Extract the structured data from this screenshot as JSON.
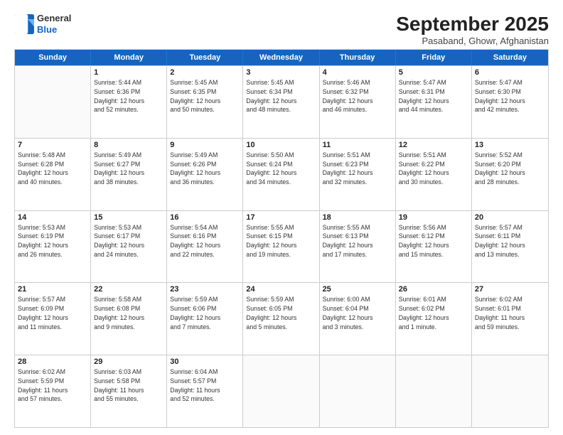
{
  "logo": {
    "general": "General",
    "blue": "Blue"
  },
  "title": "September 2025",
  "subtitle": "Pasaband, Ghowr, Afghanistan",
  "days": [
    "Sunday",
    "Monday",
    "Tuesday",
    "Wednesday",
    "Thursday",
    "Friday",
    "Saturday"
  ],
  "weeks": [
    [
      {
        "day": "",
        "info": ""
      },
      {
        "day": "1",
        "info": "Sunrise: 5:44 AM\nSunset: 6:36 PM\nDaylight: 12 hours\nand 52 minutes."
      },
      {
        "day": "2",
        "info": "Sunrise: 5:45 AM\nSunset: 6:35 PM\nDaylight: 12 hours\nand 50 minutes."
      },
      {
        "day": "3",
        "info": "Sunrise: 5:45 AM\nSunset: 6:34 PM\nDaylight: 12 hours\nand 48 minutes."
      },
      {
        "day": "4",
        "info": "Sunrise: 5:46 AM\nSunset: 6:32 PM\nDaylight: 12 hours\nand 46 minutes."
      },
      {
        "day": "5",
        "info": "Sunrise: 5:47 AM\nSunset: 6:31 PM\nDaylight: 12 hours\nand 44 minutes."
      },
      {
        "day": "6",
        "info": "Sunrise: 5:47 AM\nSunset: 6:30 PM\nDaylight: 12 hours\nand 42 minutes."
      }
    ],
    [
      {
        "day": "7",
        "info": "Sunrise: 5:48 AM\nSunset: 6:28 PM\nDaylight: 12 hours\nand 40 minutes."
      },
      {
        "day": "8",
        "info": "Sunrise: 5:49 AM\nSunset: 6:27 PM\nDaylight: 12 hours\nand 38 minutes."
      },
      {
        "day": "9",
        "info": "Sunrise: 5:49 AM\nSunset: 6:26 PM\nDaylight: 12 hours\nand 36 minutes."
      },
      {
        "day": "10",
        "info": "Sunrise: 5:50 AM\nSunset: 6:24 PM\nDaylight: 12 hours\nand 34 minutes."
      },
      {
        "day": "11",
        "info": "Sunrise: 5:51 AM\nSunset: 6:23 PM\nDaylight: 12 hours\nand 32 minutes."
      },
      {
        "day": "12",
        "info": "Sunrise: 5:51 AM\nSunset: 6:22 PM\nDaylight: 12 hours\nand 30 minutes."
      },
      {
        "day": "13",
        "info": "Sunrise: 5:52 AM\nSunset: 6:20 PM\nDaylight: 12 hours\nand 28 minutes."
      }
    ],
    [
      {
        "day": "14",
        "info": "Sunrise: 5:53 AM\nSunset: 6:19 PM\nDaylight: 12 hours\nand 26 minutes."
      },
      {
        "day": "15",
        "info": "Sunrise: 5:53 AM\nSunset: 6:17 PM\nDaylight: 12 hours\nand 24 minutes."
      },
      {
        "day": "16",
        "info": "Sunrise: 5:54 AM\nSunset: 6:16 PM\nDaylight: 12 hours\nand 22 minutes."
      },
      {
        "day": "17",
        "info": "Sunrise: 5:55 AM\nSunset: 6:15 PM\nDaylight: 12 hours\nand 19 minutes."
      },
      {
        "day": "18",
        "info": "Sunrise: 5:55 AM\nSunset: 6:13 PM\nDaylight: 12 hours\nand 17 minutes."
      },
      {
        "day": "19",
        "info": "Sunrise: 5:56 AM\nSunset: 6:12 PM\nDaylight: 12 hours\nand 15 minutes."
      },
      {
        "day": "20",
        "info": "Sunrise: 5:57 AM\nSunset: 6:11 PM\nDaylight: 12 hours\nand 13 minutes."
      }
    ],
    [
      {
        "day": "21",
        "info": "Sunrise: 5:57 AM\nSunset: 6:09 PM\nDaylight: 12 hours\nand 11 minutes."
      },
      {
        "day": "22",
        "info": "Sunrise: 5:58 AM\nSunset: 6:08 PM\nDaylight: 12 hours\nand 9 minutes."
      },
      {
        "day": "23",
        "info": "Sunrise: 5:59 AM\nSunset: 6:06 PM\nDaylight: 12 hours\nand 7 minutes."
      },
      {
        "day": "24",
        "info": "Sunrise: 5:59 AM\nSunset: 6:05 PM\nDaylight: 12 hours\nand 5 minutes."
      },
      {
        "day": "25",
        "info": "Sunrise: 6:00 AM\nSunset: 6:04 PM\nDaylight: 12 hours\nand 3 minutes."
      },
      {
        "day": "26",
        "info": "Sunrise: 6:01 AM\nSunset: 6:02 PM\nDaylight: 12 hours\nand 1 minute."
      },
      {
        "day": "27",
        "info": "Sunrise: 6:02 AM\nSunset: 6:01 PM\nDaylight: 11 hours\nand 59 minutes."
      }
    ],
    [
      {
        "day": "28",
        "info": "Sunrise: 6:02 AM\nSunset: 5:59 PM\nDaylight: 11 hours\nand 57 minutes."
      },
      {
        "day": "29",
        "info": "Sunrise: 6:03 AM\nSunset: 5:58 PM\nDaylight: 11 hours\nand 55 minutes."
      },
      {
        "day": "30",
        "info": "Sunrise: 6:04 AM\nSunset: 5:57 PM\nDaylight: 11 hours\nand 52 minutes."
      },
      {
        "day": "",
        "info": ""
      },
      {
        "day": "",
        "info": ""
      },
      {
        "day": "",
        "info": ""
      },
      {
        "day": "",
        "info": ""
      }
    ]
  ]
}
